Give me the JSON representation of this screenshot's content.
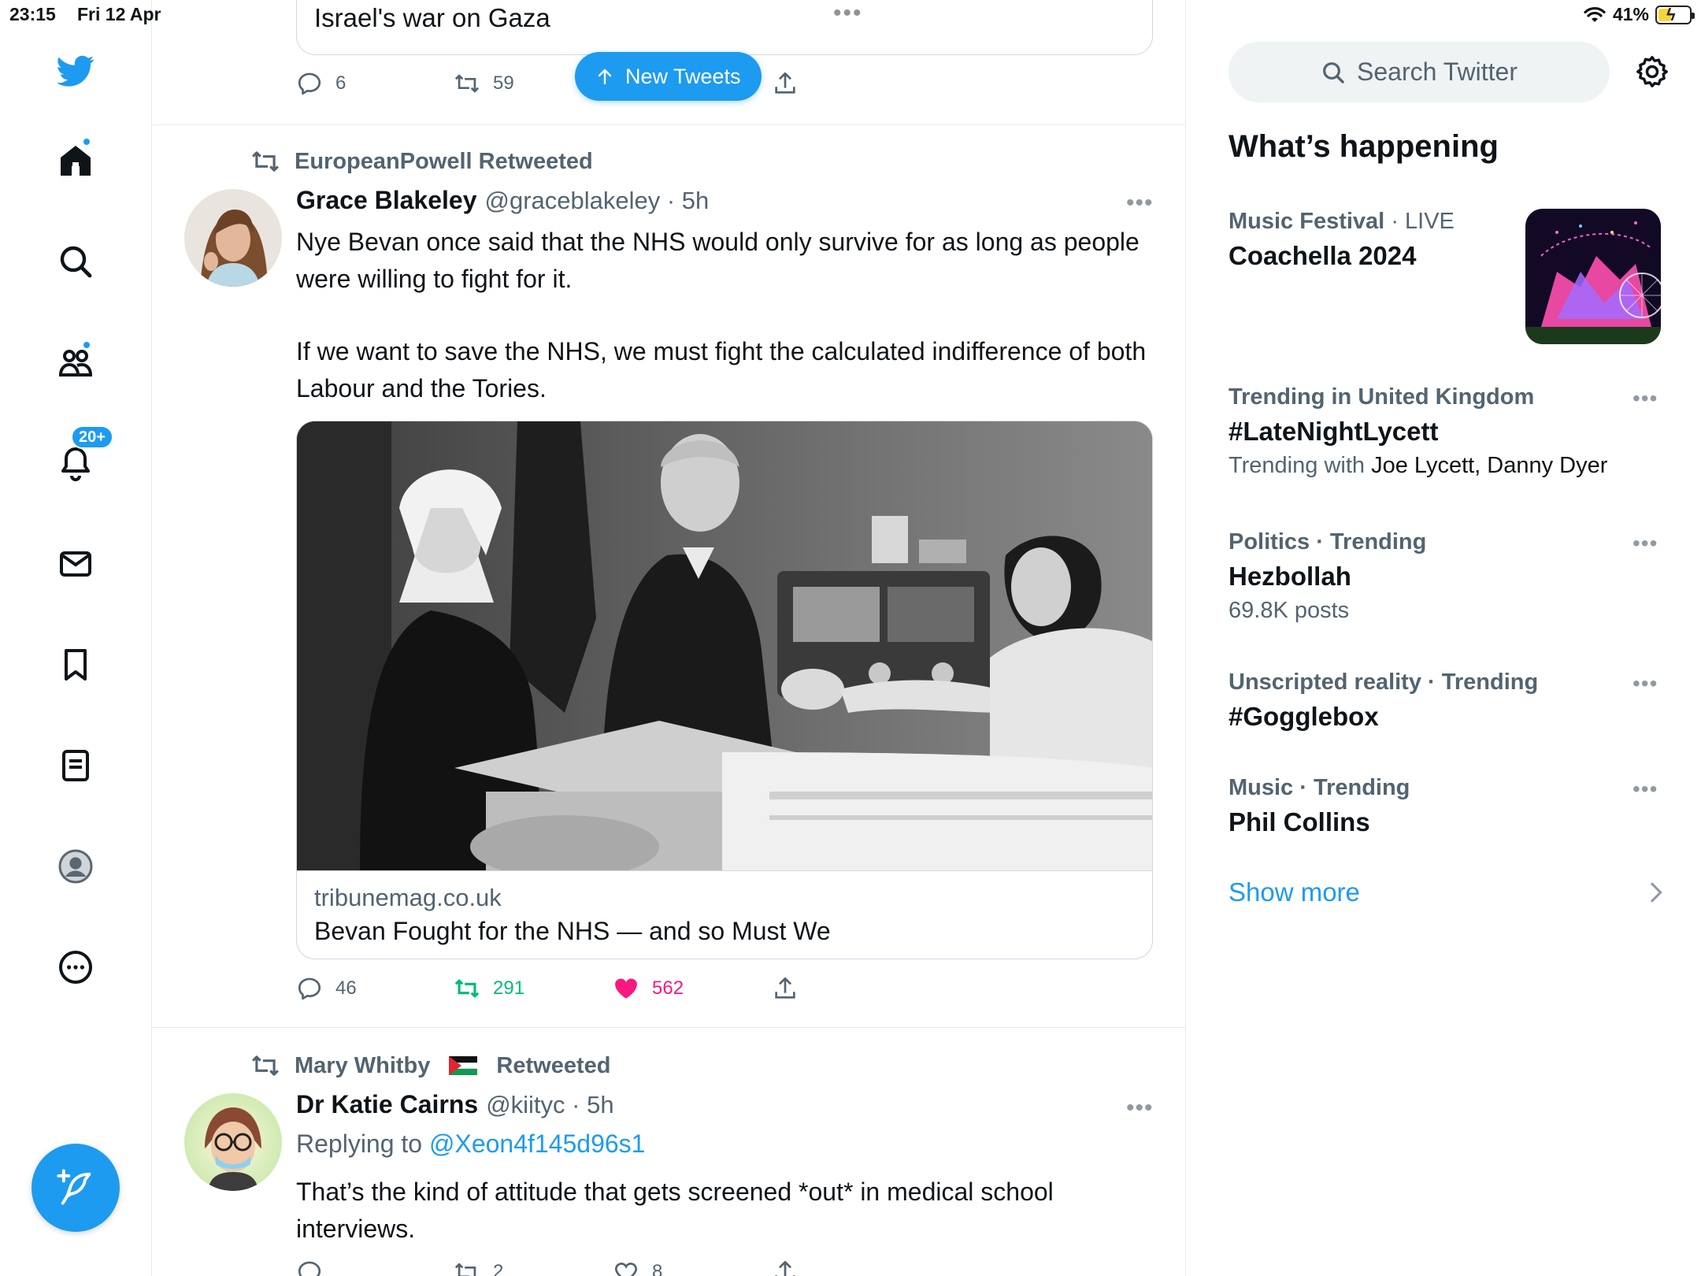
{
  "status_bar": {
    "time": "23:15",
    "date": "Fri 12 Apr",
    "battery": "41%",
    "battery_level": 0.41
  },
  "nav": {
    "notifications_badge": "20+"
  },
  "timeline": {
    "new_tweets_label": "New Tweets",
    "prev_tweet": {
      "card_text_partial": "Israel's war on Gaza",
      "replies": "6",
      "retweets": "59"
    },
    "tweet1": {
      "retweeted_by": "EuropeanPowell Retweeted",
      "name": "Grace Blakeley",
      "handle": "@graceblakeley · 5h",
      "paragraphs": [
        "Nye Bevan once said that the NHS would only survive for as long as people were willing to fight for it.",
        "If we want to save the NHS, we must fight the calculated indifference of both Labour and the Tories."
      ],
      "card_domain": "tribunemag.co.uk",
      "card_title": "Bevan Fought for the NHS — and so Must We",
      "replies": "46",
      "retweets": "291",
      "likes": "562"
    },
    "tweet2": {
      "retweeted_by_name": "Mary Whitby",
      "retweeted_suffix": "Retweeted",
      "name": "Dr Katie Cairns",
      "handle": "@kiityc · 5h",
      "replying_prefix": "Replying to",
      "replying_to": "@Xeon4f145d96s1",
      "text": "That’s the kind of attitude that gets screened *out* in medical school interviews.",
      "retweets": "2",
      "likes": "8"
    }
  },
  "sidebar": {
    "search_placeholder": "Search Twitter",
    "section_title": "What’s happening",
    "trends": [
      {
        "category": "Music Festival",
        "status": "· LIVE",
        "title": "Coachella 2024"
      },
      {
        "category": "Trending in United Kingdom",
        "title": "#LateNightLycett",
        "sub_prefix": "Trending with",
        "sub_names": "Joe Lycett, Danny Dyer"
      },
      {
        "category": "Politics · Trending",
        "title": "Hezbollah",
        "sub": "69.8K posts"
      },
      {
        "category": "Unscripted reality · Trending",
        "title": "#Gogglebox"
      },
      {
        "category": "Music · Trending",
        "title": "Phil Collins"
      }
    ],
    "show_more": "Show more"
  },
  "colors": {
    "accent": "#1d9bf0",
    "retweet_green": "#00ba7c",
    "like_pink": "#f91880",
    "muted": "#536471"
  }
}
